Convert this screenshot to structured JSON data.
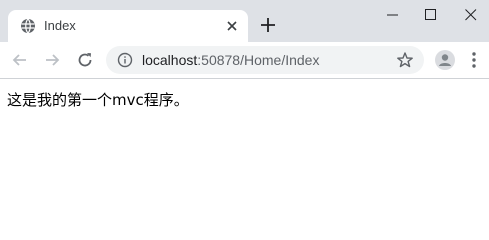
{
  "tab": {
    "title": "Index",
    "favicon": "globe-icon",
    "close_icon": "close-icon"
  },
  "new_tab_icon": "plus-icon",
  "window_controls": [
    "minimize-icon",
    "maximize-icon",
    "close-icon"
  ],
  "toolbar": {
    "back_icon": "arrow-left-icon",
    "forward_icon": "arrow-right-icon",
    "reload_icon": "reload-icon",
    "info_icon": "info-icon",
    "star_icon": "star-icon",
    "avatar_icon": "avatar-icon",
    "menu_icon": "kebab-menu-icon"
  },
  "address_bar": {
    "host": "localhost",
    "rest": ":50878/Home/Index"
  },
  "page": {
    "text": "这是我的第一个mvc程序。"
  },
  "colors": {
    "tabstrip": "#dee1e6",
    "omnibox": "#f1f3f4",
    "icon": "#5f6368",
    "disabled_icon": "#bdc1c6"
  }
}
